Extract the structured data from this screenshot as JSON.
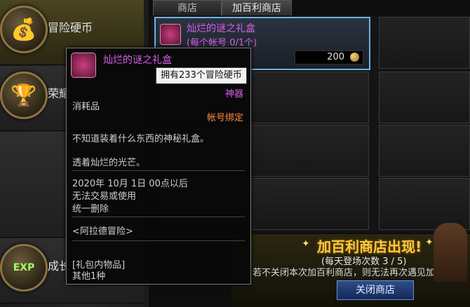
{
  "categories": [
    {
      "label": "冒险硬币",
      "icon": "treasure-chest-icon"
    },
    {
      "label": "荣耀",
      "icon": "trophy-cup-icon"
    },
    {
      "label": "",
      "icon": "empty"
    },
    {
      "label": "成长",
      "icon": "exp-capsule-icon",
      "badge": "EXP"
    }
  ],
  "tabs": [
    "商店",
    "加百利商店"
  ],
  "shop_item": {
    "name": "灿烂的谜之礼盒",
    "limit": "(每个帐号 0/1个)",
    "price": "200"
  },
  "tooltip": {
    "title": "灿烂的谜之礼盒",
    "rarity": "神器",
    "type": "消耗品",
    "binding": "帐号绑定",
    "desc1": "不知道装着什么东西的神秘礼盒。",
    "desc2": "透着灿烂的光芒。",
    "expiry1": "2020年 10月 1日 00点以后",
    "expiry2": "无法交易或使用",
    "expiry3": "统一删除",
    "source": "<阿拉德冒险>",
    "contents_header": "[礼包内物品]",
    "contents_value": "其他1种"
  },
  "hint": "拥有233个冒险硬币",
  "banner": {
    "title": "加百利商店出现!",
    "subtitle": "(每天登场次数 3 / 5)",
    "note": "若不关闭本次加百利商店，则无法再次遇见加百",
    "close_label": "关闭商店"
  },
  "colors": {
    "item_name": "#d65fe8",
    "binding": "#ff8a3d",
    "accent": "#6fb1e0",
    "banner_title": "#f7c842"
  }
}
